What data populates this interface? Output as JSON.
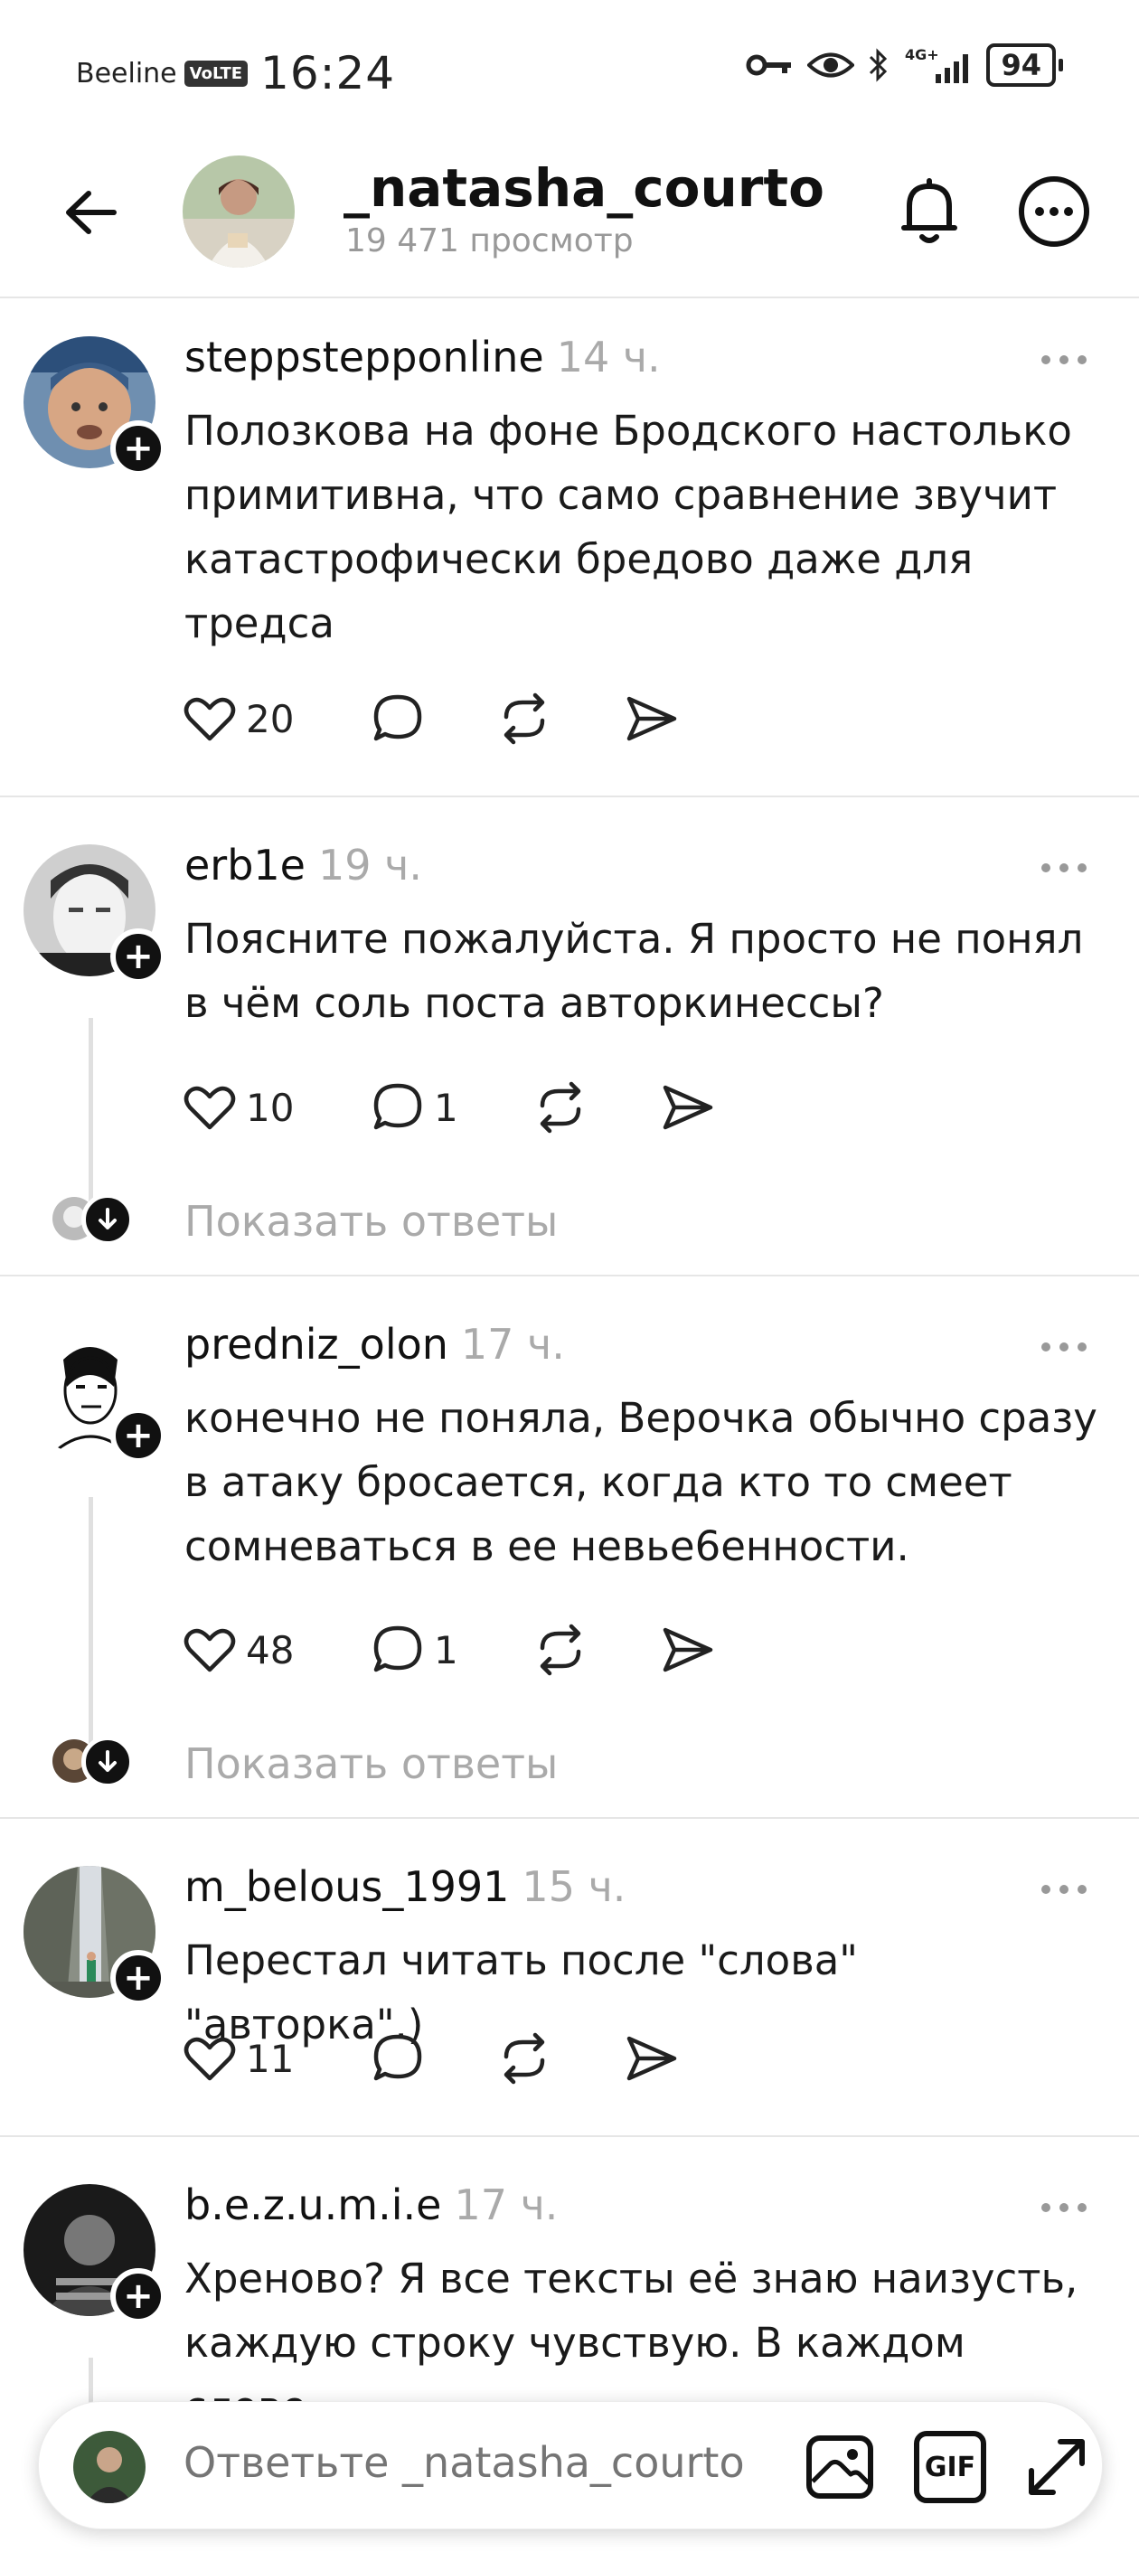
{
  "status_bar": {
    "carrier": "Beeline",
    "volte": "VoLTE",
    "time": "16:24",
    "network": "4G+",
    "battery": "94"
  },
  "header": {
    "title": "_natasha_courto",
    "subtitle": "19 471 просмотр"
  },
  "comments": [
    {
      "username": "steppstepponline",
      "time": "14 ч.",
      "text": "Полозкова на фоне Бродского настолько примитивна, что само сравнение звучит катастрофически бредово даже для тредса",
      "likes": "20",
      "replies": ""
    },
    {
      "username": "erb1e",
      "time": "19 ч.",
      "text": "Поясните пожалуйста. Я просто не понял в чём соль поста авторкинессы?",
      "likes": "10",
      "replies": "1",
      "show_replies": "Показать ответы"
    },
    {
      "username": "predniz_olon",
      "time": "17 ч.",
      "text": "конечно не поняла, Верочка обычно сразу в атаку бросается, когда кто то смеет сомневаться в ее невье6енности.",
      "likes": "48",
      "replies": "1",
      "show_replies": "Показать ответы"
    },
    {
      "username": "m_belous_1991",
      "time": "15 ч.",
      "text": "Перестал читать после \"слова\" \"авторка\".)",
      "likes": "11",
      "replies": ""
    },
    {
      "username": "b.e.z.u.m.i.e",
      "time": "17 ч.",
      "text": "Хреново? Я все тексты её знаю наизусть, каждую строку чувствую. В каждом слове"
    }
  ],
  "reply_bar": {
    "placeholder": "Ответьте _natasha_courto",
    "gif_label": "GIF"
  },
  "colors": {
    "text": "#111111",
    "muted": "#aaaaaa",
    "divider": "#e6e6e6",
    "badge": "#111111"
  }
}
